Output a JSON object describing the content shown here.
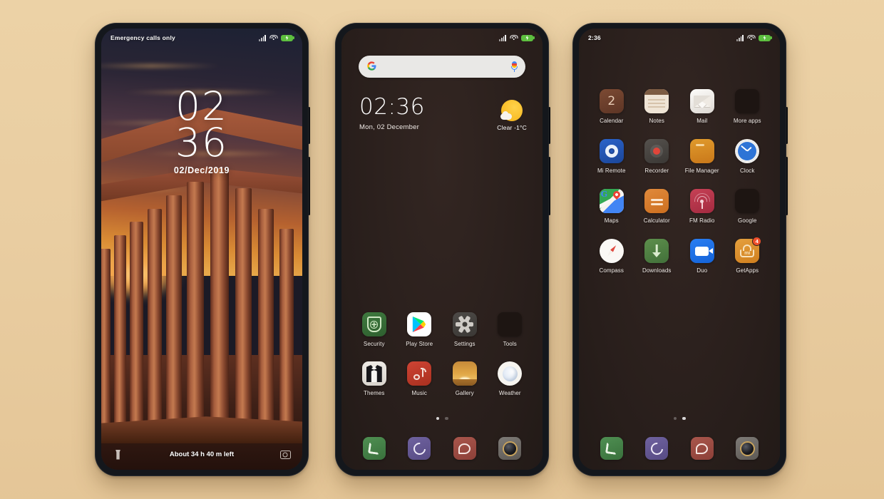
{
  "background": {
    "color_top": "#ecd2a6",
    "color_bottom": "#e4c596"
  },
  "phones": [
    {
      "id": "lock-screen",
      "statusbar": {
        "left_text": "Emergency calls only",
        "icons": [
          "signal-icon",
          "wifi-icon",
          "battery-charging-icon"
        ]
      },
      "clock": {
        "hours": "02",
        "minutes": "36",
        "date": "02/Dec/2019"
      },
      "bottom": {
        "left_icon": "flashlight-icon",
        "battery_text": "About 34 h 40 m left",
        "right_icon": "camera-icon"
      },
      "wallpaper": "greek-temple-sunset"
    },
    {
      "id": "home-screen-page-1",
      "statusbar": {
        "left_text": "",
        "icons": [
          "signal-icon",
          "wifi-icon",
          "battery-charging-icon"
        ]
      },
      "search": {
        "logo": "G",
        "placeholder": "",
        "mic": "mic-icon"
      },
      "clock_widget": {
        "time": "02:36",
        "date": "Mon, 02 December"
      },
      "weather_widget": {
        "icon": "sun-cloud-icon",
        "condition": "Clear",
        "temperature": "-1°C",
        "text": "Clear   -1°C"
      },
      "apps": [
        {
          "label": "Security",
          "icon": "security-icon"
        },
        {
          "label": "Play Store",
          "icon": "play-store-icon"
        },
        {
          "label": "Settings",
          "icon": "settings-icon"
        },
        {
          "label": "Tools",
          "icon": "folder-icon"
        },
        {
          "label": "Themes",
          "icon": "themes-icon"
        },
        {
          "label": "Music",
          "icon": "music-icon"
        },
        {
          "label": "Gallery",
          "icon": "gallery-icon"
        },
        {
          "label": "Weather",
          "icon": "weather-moon-icon"
        }
      ],
      "page_dots": {
        "count": 2,
        "active": 0
      },
      "dock": [
        {
          "label": "Phone",
          "icon": "phone-icon"
        },
        {
          "label": "Contacts",
          "icon": "contacts-icon"
        },
        {
          "label": "Messages",
          "icon": "messages-icon"
        },
        {
          "label": "Camera",
          "icon": "camera-icon"
        }
      ]
    },
    {
      "id": "home-screen-page-2",
      "statusbar": {
        "left_text": "2:36",
        "icons": [
          "signal-icon",
          "wifi-icon",
          "battery-charging-icon"
        ]
      },
      "apps": [
        {
          "label": "Calendar",
          "icon": "calendar-icon",
          "day": "2"
        },
        {
          "label": "Notes",
          "icon": "notes-icon"
        },
        {
          "label": "Mail",
          "icon": "mail-icon"
        },
        {
          "label": "More apps",
          "icon": "folder-icon"
        },
        {
          "label": "Mi Remote",
          "icon": "mi-remote-icon"
        },
        {
          "label": "Recorder",
          "icon": "recorder-icon"
        },
        {
          "label": "File Manager",
          "icon": "file-manager-icon"
        },
        {
          "label": "Clock",
          "icon": "clock-icon"
        },
        {
          "label": "Maps",
          "icon": "maps-icon"
        },
        {
          "label": "Calculator",
          "icon": "calculator-icon"
        },
        {
          "label": "FM Radio",
          "icon": "fm-radio-icon"
        },
        {
          "label": "Google",
          "icon": "folder-icon"
        },
        {
          "label": "Compass",
          "icon": "compass-icon"
        },
        {
          "label": "Downloads",
          "icon": "downloads-icon"
        },
        {
          "label": "Duo",
          "icon": "duo-icon"
        },
        {
          "label": "GetApps",
          "icon": "getapps-icon",
          "badge": "4"
        }
      ],
      "page_dots": {
        "count": 2,
        "active": 1
      },
      "dock": [
        {
          "label": "Phone",
          "icon": "phone-icon"
        },
        {
          "label": "Contacts",
          "icon": "contacts-icon"
        },
        {
          "label": "Messages",
          "icon": "messages-icon"
        },
        {
          "label": "Camera",
          "icon": "camera-icon"
        }
      ]
    }
  ]
}
